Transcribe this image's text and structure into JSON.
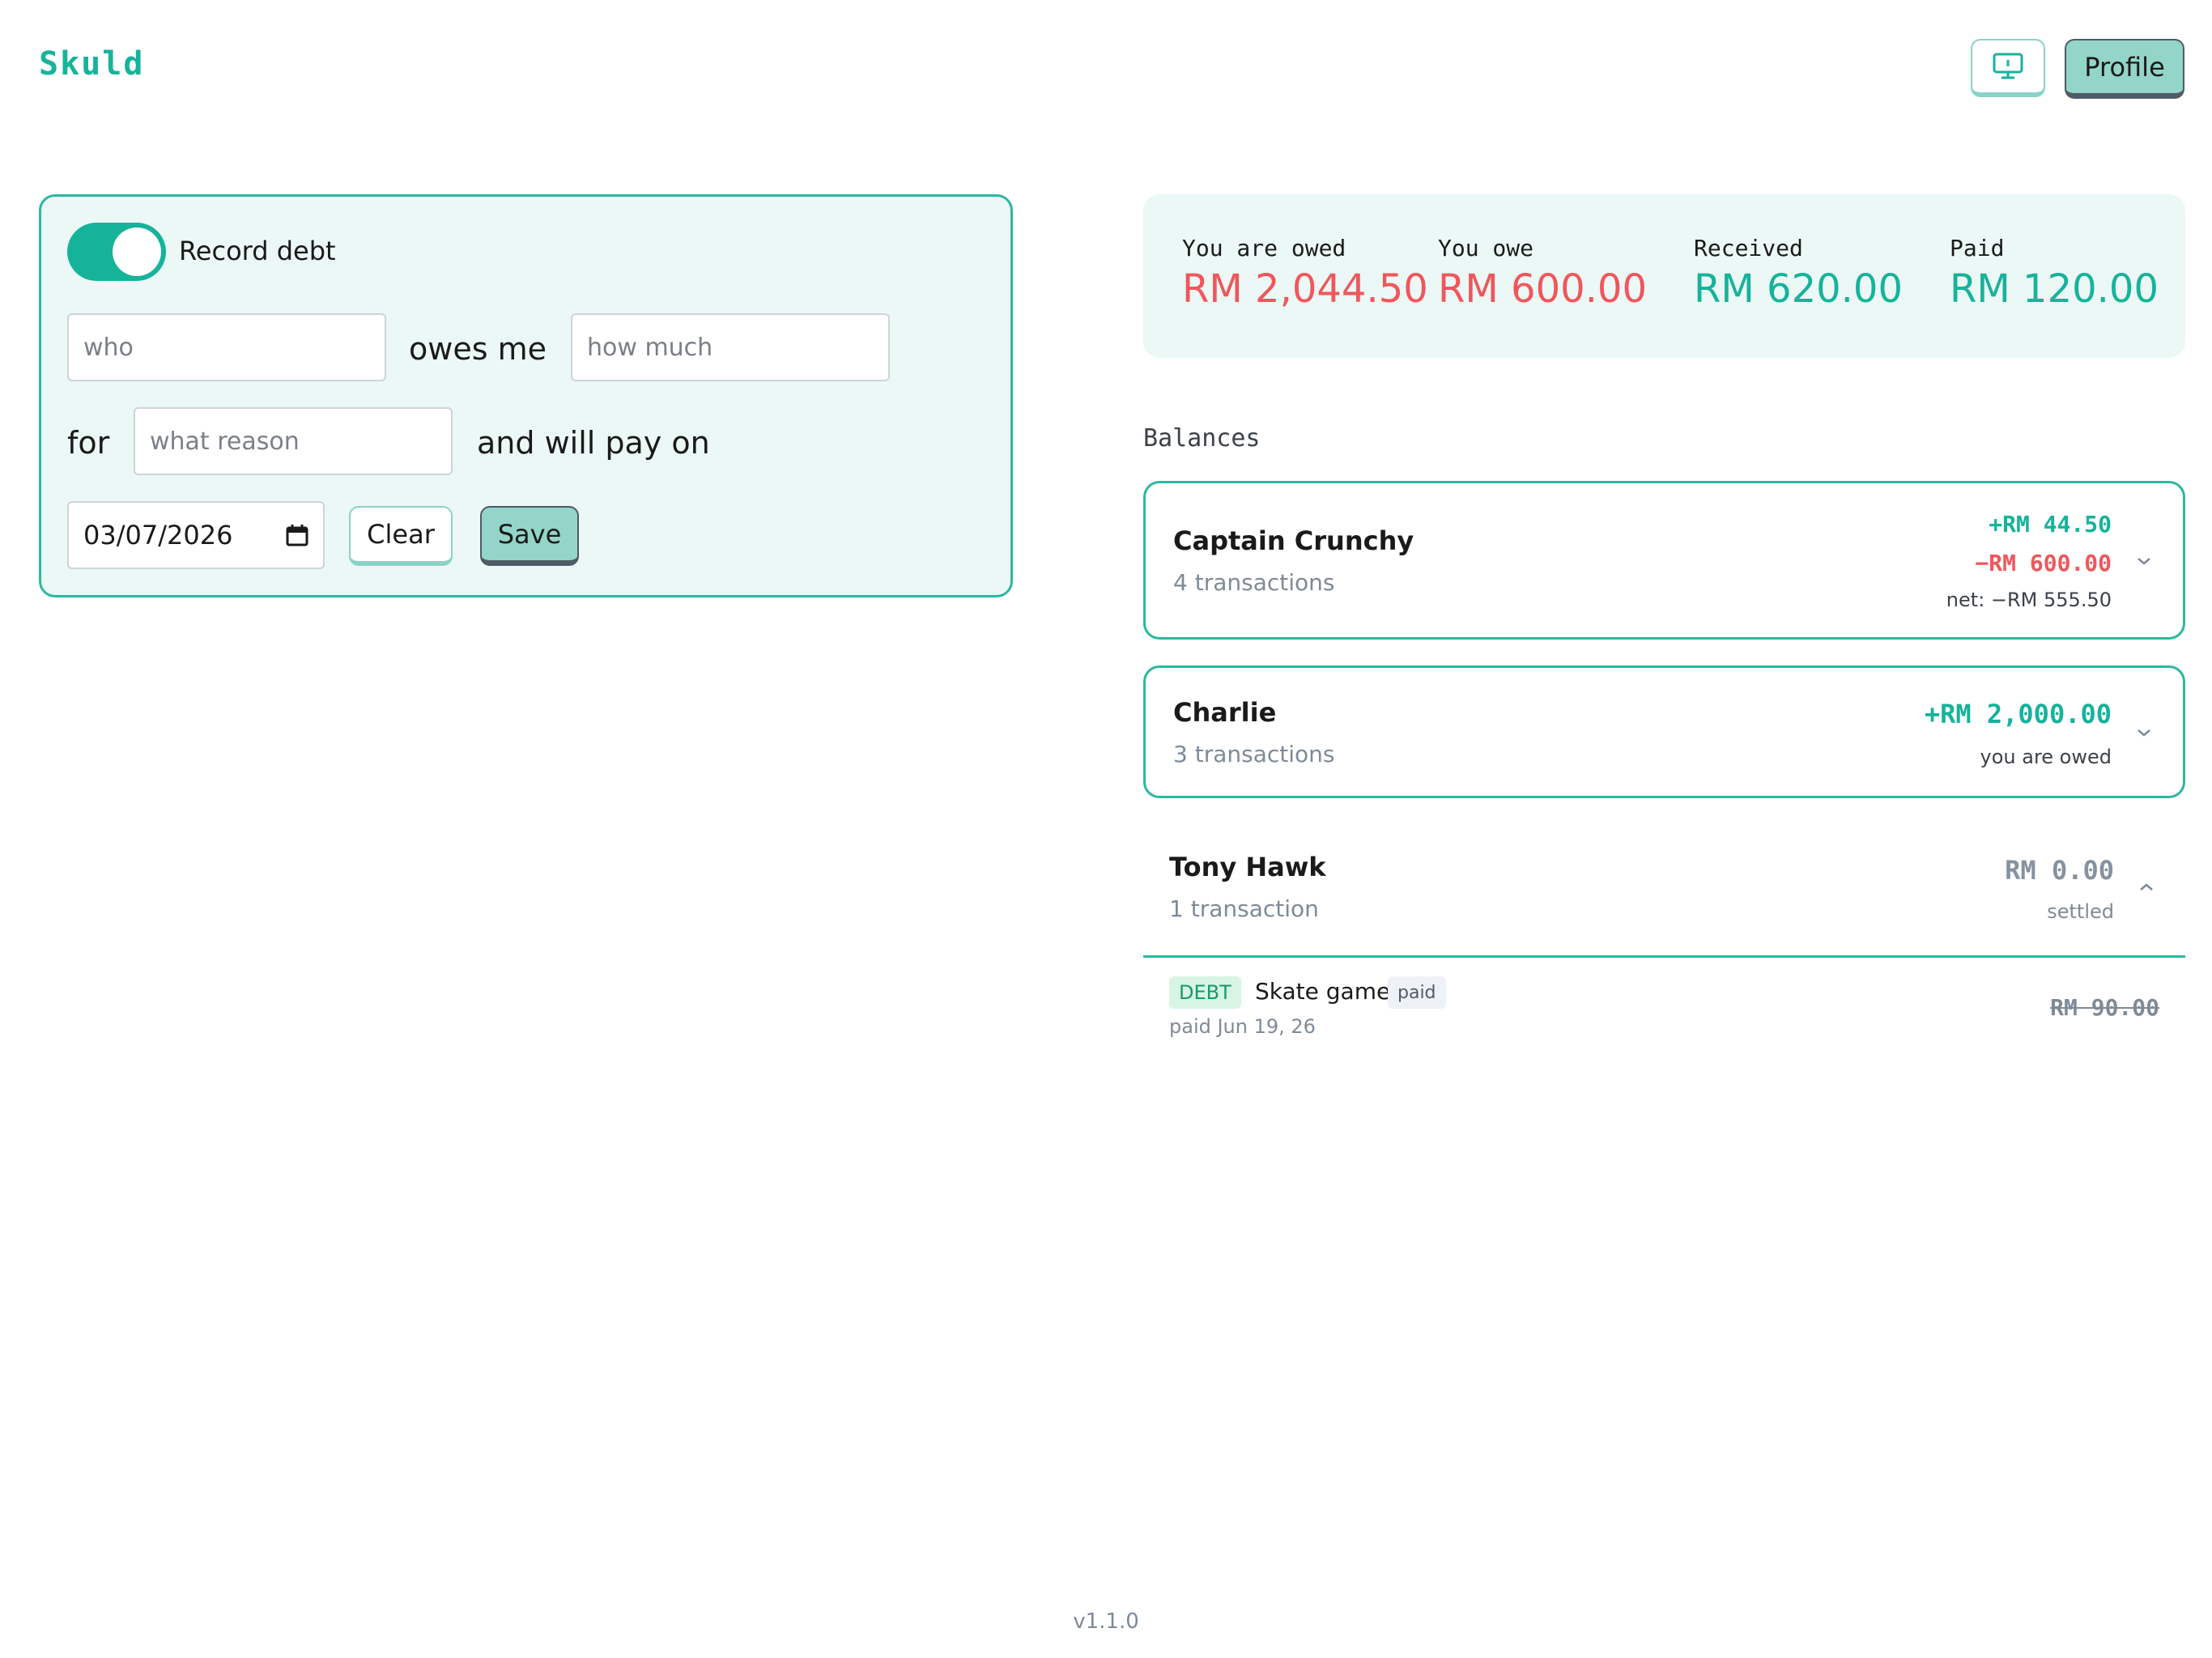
{
  "app": {
    "logo": "Skuld",
    "version": "v1.1.0"
  },
  "header": {
    "profile_label": "Profile",
    "monitor_icon": "monitor-icon"
  },
  "form": {
    "toggle_label": "Record debt",
    "toggle_on": true,
    "who_placeholder": "who",
    "owes_me": "owes me",
    "amount_placeholder": "how much",
    "for_word": "for",
    "reason_placeholder": "what reason",
    "pay_on": "and will pay on",
    "date_value": "03/07/2026",
    "clear_label": "Clear",
    "save_label": "Save"
  },
  "summary": {
    "owed_label": "You are owed",
    "owed_value": "RM 2,044.50",
    "owe_label": "You owe",
    "owe_value": "RM 600.00",
    "received_label": "Received",
    "received_value": "RM 620.00",
    "paid_label": "Paid",
    "paid_value": "RM 120.00",
    "colors": {
      "negative": "#f0565c",
      "positive": "#16b39b"
    }
  },
  "balances": {
    "heading": "Balances",
    "items": [
      {
        "name": "Captain Crunchy",
        "sub": "4 transactions",
        "plus": "+RM 44.50",
        "minus": "−RM 600.00",
        "note": "net: −RM 555.50"
      },
      {
        "name": "Charlie",
        "sub": "3 transactions",
        "amount": "+RM 2,000.00",
        "note": "you are owed"
      },
      {
        "name": "Tony Hawk",
        "sub": "1 transaction",
        "amount": "RM 0.00",
        "note": "settled",
        "transactions": [
          {
            "type": "DEBT",
            "title": "Skate game",
            "status": "paid",
            "date": "paid Jun 19, 26",
            "amount": "RM 90.00"
          }
        ]
      }
    ]
  }
}
